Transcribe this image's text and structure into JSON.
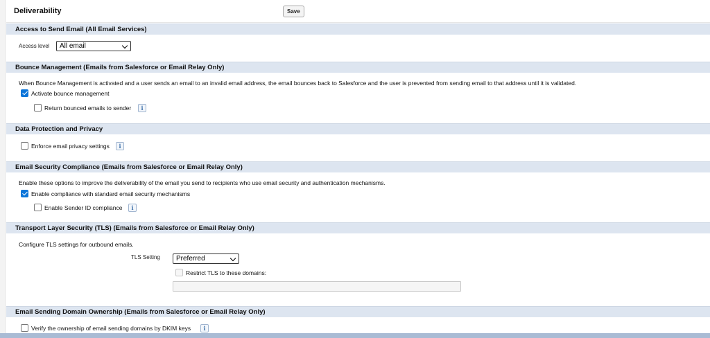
{
  "header": {
    "title": "Deliverability",
    "save_label": "Save"
  },
  "access": {
    "title": "Access to Send Email (All Email Services)",
    "access_level_label": "Access level",
    "access_level_value": "All email"
  },
  "bounce": {
    "title": "Bounce Management (Emails from Salesforce or Email Relay Only)",
    "description": "When Bounce Management is activated and a user sends an email to an invalid email address, the email bounces back to Salesforce and the user is prevented from sending email to that address until it is validated.",
    "activate_label": "Activate bounce management",
    "activate_checked": true,
    "return_label": "Return bounced emails to sender",
    "return_checked": false
  },
  "privacy": {
    "title": "Data Protection and Privacy",
    "enforce_label": "Enforce email privacy settings",
    "enforce_checked": false
  },
  "security": {
    "title": "Email Security Compliance (Emails from Salesforce or Email Relay Only)",
    "description": "Enable these options to improve the deliverability of the email you send to recipients who use email security and authentication mechanisms.",
    "compliance_label": "Enable compliance with standard email security mechanisms",
    "compliance_checked": true,
    "senderid_label": "Enable Sender ID compliance",
    "senderid_checked": false
  },
  "tls": {
    "title": "Transport Layer Security (TLS) (Emails from Salesforce or Email Relay Only)",
    "description": "Configure TLS settings for outbound emails.",
    "setting_label": "TLS Setting",
    "setting_value": "Preferred",
    "restrict_label": "Restrict TLS to these domains:",
    "restrict_checked": false,
    "domains_value": ""
  },
  "domain_ownership": {
    "title": "Email Sending Domain Ownership (Emails from Salesforce or Email Relay Only)",
    "verify_label": "Verify the ownership of email sending domains by DKIM keys",
    "verify_checked": false
  },
  "icons": {
    "info": "info-icon",
    "info_glyph": "i"
  },
  "colors": {
    "section_header_bg": "#dde5f0",
    "checkbox_checked": "#0b75d9",
    "bottom_bar": "#a9bbd4"
  }
}
